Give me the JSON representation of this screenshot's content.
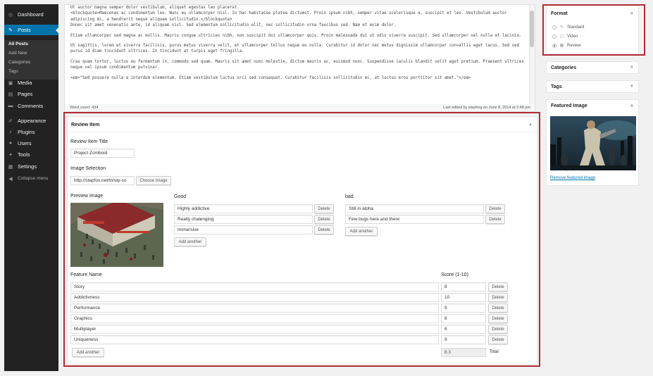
{
  "sidebar": {
    "dashboard": "Dashboard",
    "posts": "Posts",
    "all_posts": "All Posts",
    "add_new": "Add New",
    "categories": "Categories",
    "tags": "Tags",
    "media": "Media",
    "pages": "Pages",
    "comments": "Comments",
    "appearance": "Appearance",
    "plugins": "Plugins",
    "users": "Users",
    "tools": "Tools",
    "settings": "Settings",
    "collapse": "Collapse menu"
  },
  "editor": {
    "lines": [
      "Ut auctor magna semper dolor vestibulum, aliquet egestas leo placerat.",
      "<blockquote>Maecenas ac condimentum leo. Nunc eu ullamcorper nisl. In hac habitasse platea dictumst. Proin ipsum nibh, semper vitae scelerisque a, suscipit et leo. Vestibulum auctor adipiscing mi, a hendrerit neque aliquam sollicitudin.</blockquote>",
      "Donec sit amet venenatis ante, id aliquam nisl. Sed elementum sollicitudin elit, nec sollicitudin urna faucibus sed. Nam et enim dolor.",
      "Etiam ullamcorper sed magna ac mollis. Mauris congue ultricies nibh, non suscipit dui ullamcorper quis. Proin malesuada dui ut odio viverra suscipit. Sed ullamcorper vel nulla et lacinia.",
      "Ut sagittis, lorem et viverra facilisis, purus metus viverra velit, et ullamcorper tellus neque eu nulla. Curabitur id dolor nec metus dignissim ullamcorper convallis eget lacus. Sed sed purus id diam tincidunt ultrices. In tincidunt at turpis eget fringilla.",
      "Cras quam tortor, luctus eu fermentum in, commodo sed quam. Mauris sit amet nunc molestie, dictum mauris ac, euismod nunc. Suspendisse iaculis blandit velit eget pretium. Praesent ultrices neque vel ipsum condimentum pulvinar.",
      "<em>\"Sed posuere nulla a interdum elementum. Etiam vestibulum luctus orci sed consequat. Curabitur facilisis sollicitudin mi, at luctus eros porttitor sit amet.\"</em>"
    ],
    "word_count": "Word count: 434",
    "last_edited": "Last edited by stephog on June 8, 2014 at 2:48 pm"
  },
  "review": {
    "box_title": "Review Item",
    "item_title_label": "Review Item Title",
    "item_title_value": "Project Zomboid",
    "image_selection_label": "Image Selection",
    "image_url": "http://stepfox.net/tn/wp-co",
    "choose_image": "Choose Image",
    "preview_label": "Preview Image",
    "good_label": "Good",
    "good_items": [
      "Highly addictive",
      "Really chalenging",
      "Immersive"
    ],
    "bad_label": "bad",
    "bad_items": [
      "Still in alpha",
      "Few bugs here and there"
    ],
    "delete": "Delete",
    "add_another": "Add another",
    "feature_name_label": "Feature Name",
    "score_label": "Score (1-10)",
    "features": [
      {
        "name": "Story",
        "score": "8"
      },
      {
        "name": "Addictivness",
        "score": "10"
      },
      {
        "name": "Performance",
        "score": "9"
      },
      {
        "name": "Graphics",
        "score": "8"
      },
      {
        "name": "Multiplayer",
        "score": "6"
      },
      {
        "name": "Uniqueness",
        "score": "9"
      }
    ],
    "total_value": "8.3",
    "total_label": "Total"
  },
  "format": {
    "title": "Format",
    "options": [
      "Standard",
      "Video",
      "Review"
    ],
    "selected": "Review"
  },
  "categories_title": "Categories",
  "tags_title": "Tags",
  "featured": {
    "title": "Featured Image",
    "remove_link": "Remove featured image"
  },
  "colors": {
    "highlight": "#b22a36",
    "admin_bar": "#222222",
    "active_menu": "#0073aa"
  }
}
